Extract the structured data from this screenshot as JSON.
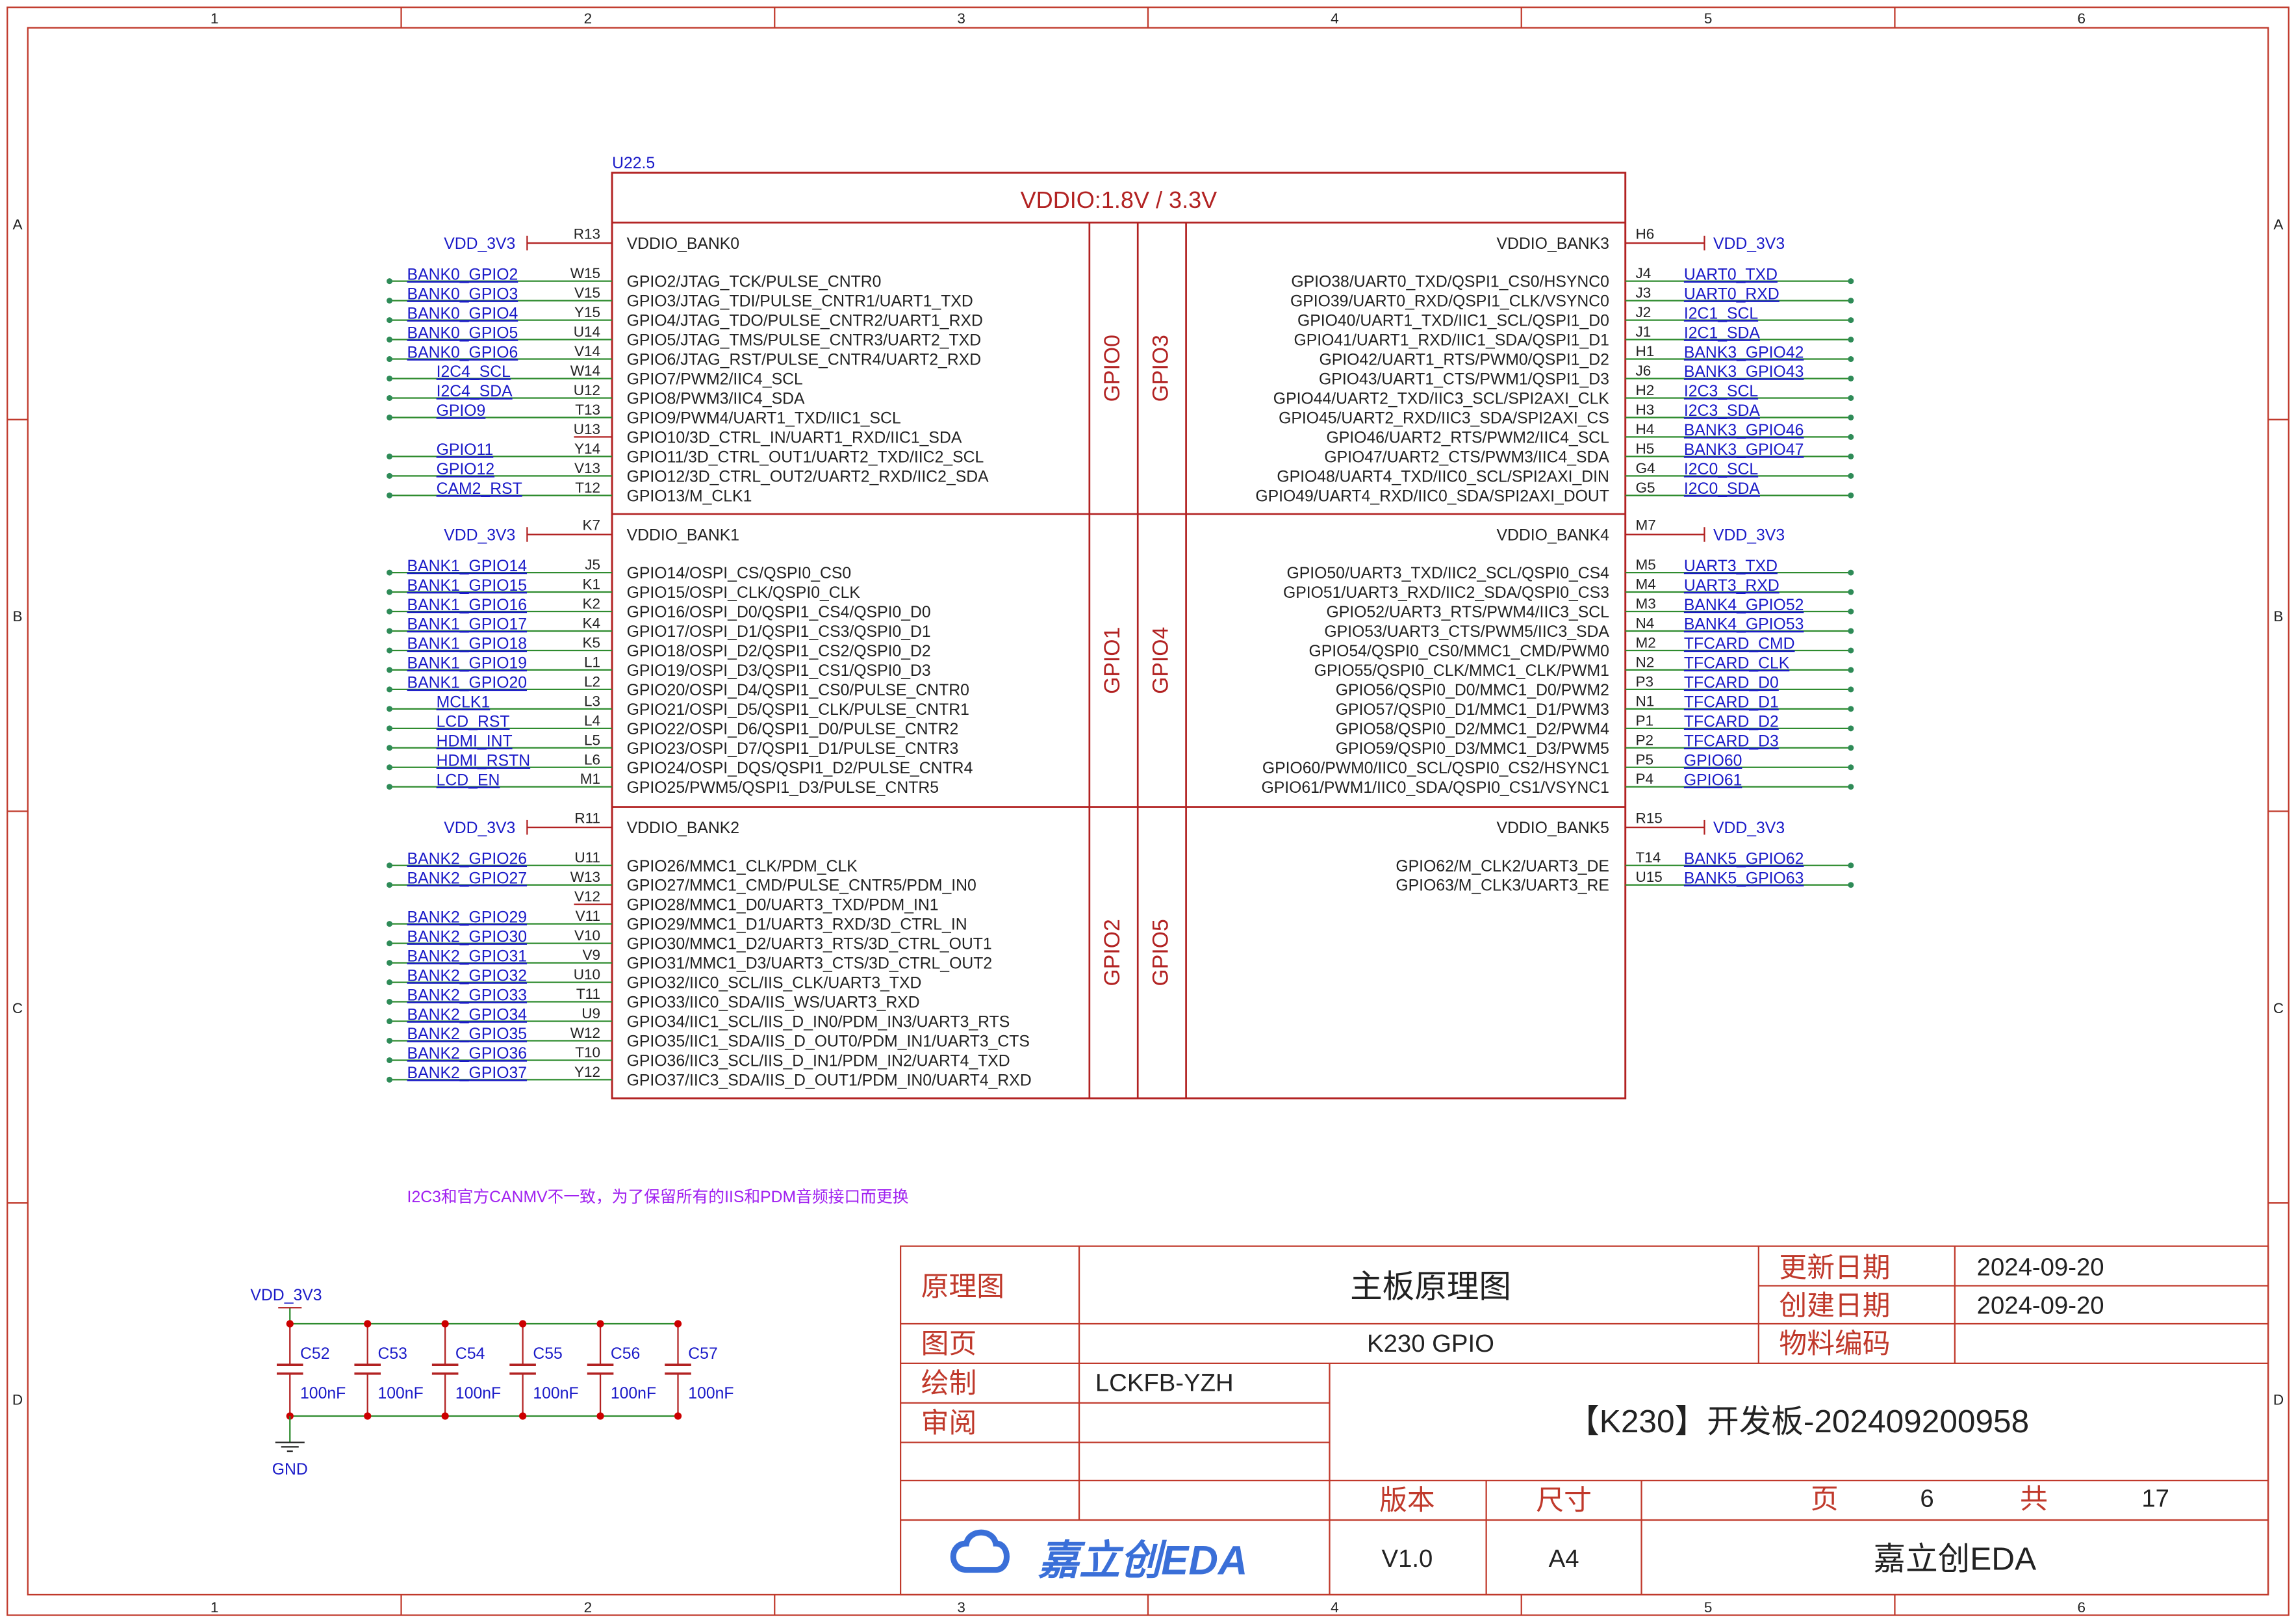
{
  "frame": {
    "columns": [
      "1",
      "2",
      "3",
      "4",
      "5",
      "6"
    ],
    "rows": [
      "A",
      "B",
      "C",
      "D"
    ]
  },
  "colors": {
    "frame": "#c0392b",
    "body": "#b22222",
    "pin": "#b22222",
    "net": "#1a1ac8",
    "wire": "#2e8b2e",
    "note": "#a020f0",
    "pad": "#2e8b57",
    "junction": "#cc0000",
    "black": "#222222",
    "logo": "#3a6fd8"
  },
  "chip": {
    "designator": "U22.5",
    "title": "VDDIO:1.8V / 3.3V",
    "banks": [
      {
        "name": "VDDIO_BANK0",
        "group": "GPIO0",
        "side": "left",
        "power": {
          "net": "VDD_3V3",
          "pin": "R13"
        },
        "pins": [
          {
            "net": "BANK0_GPIO2",
            "pin": "W15",
            "func": "GPIO2/JTAG_TCK/PULSE_CNTR0"
          },
          {
            "net": "BANK0_GPIO3",
            "pin": "V15",
            "func": "GPIO3/JTAG_TDI/PULSE_CNTR1/UART1_TXD"
          },
          {
            "net": "BANK0_GPIO4",
            "pin": "Y15",
            "func": "GPIO4/JTAG_TDO/PULSE_CNTR2/UART1_RXD"
          },
          {
            "net": "BANK0_GPIO5",
            "pin": "U14",
            "func": "GPIO5/JTAG_TMS/PULSE_CNTR3/UART2_TXD"
          },
          {
            "net": "BANK0_GPIO6",
            "pin": "V14",
            "func": "GPIO6/JTAG_RST/PULSE_CNTR4/UART2_RXD"
          },
          {
            "net": "I2C4_SCL",
            "pin": "W14",
            "func": "GPIO7/PWM2/IIC4_SCL"
          },
          {
            "net": "I2C4_SDA",
            "pin": "U12",
            "func": "GPIO8/PWM3/IIC4_SDA"
          },
          {
            "net": "GPIO9",
            "pin": "T13",
            "func": "GPIO9/PWM4/UART1_TXD/IIC1_SCL"
          },
          {
            "net": "",
            "pin": "U13",
            "func": "GPIO10/3D_CTRL_IN/UART1_RXD/IIC1_SDA"
          },
          {
            "net": "GPIO11",
            "pin": "Y14",
            "func": "GPIO11/3D_CTRL_OUT1/UART2_TXD/IIC2_SCL"
          },
          {
            "net": "GPIO12",
            "pin": "V13",
            "func": "GPIO12/3D_CTRL_OUT2/UART2_RXD/IIC2_SDA"
          },
          {
            "net": "CAM2_RST",
            "pin": "T12",
            "func": "GPIO13/M_CLK1"
          }
        ]
      },
      {
        "name": "VDDIO_BANK1",
        "group": "GPIO1",
        "side": "left",
        "power": {
          "net": "VDD_3V3",
          "pin": "K7"
        },
        "pins": [
          {
            "net": "BANK1_GPIO14",
            "pin": "J5",
            "func": "GPIO14/OSPI_CS/QSPI0_CS0"
          },
          {
            "net": "BANK1_GPIO15",
            "pin": "K1",
            "func": "GPIO15/OSPI_CLK/QSPI0_CLK"
          },
          {
            "net": "BANK1_GPIO16",
            "pin": "K2",
            "func": "GPIO16/OSPI_D0/QSPI1_CS4/QSPI0_D0"
          },
          {
            "net": "BANK1_GPIO17",
            "pin": "K4",
            "func": "GPIO17/OSPI_D1/QSPI1_CS3/QSPI0_D1"
          },
          {
            "net": "BANK1_GPIO18",
            "pin": "K5",
            "func": "GPIO18/OSPI_D2/QSPI1_CS2/QSPI0_D2"
          },
          {
            "net": "BANK1_GPIO19",
            "pin": "L1",
            "func": "GPIO19/OSPI_D3/QSPI1_CS1/QSPI0_D3"
          },
          {
            "net": "BANK1_GPIO20",
            "pin": "L2",
            "func": "GPIO20/OSPI_D4/QSPI1_CS0/PULSE_CNTR0"
          },
          {
            "net": "MCLK1",
            "pin": "L3",
            "func": "GPIO21/OSPI_D5/QSPI1_CLK/PULSE_CNTR1"
          },
          {
            "net": "LCD_RST",
            "pin": "L4",
            "func": "GPIO22/OSPI_D6/QSPI1_D0/PULSE_CNTR2"
          },
          {
            "net": "HDMI_INT",
            "pin": "L5",
            "func": "GPIO23/OSPI_D7/QSPI1_D1/PULSE_CNTR3"
          },
          {
            "net": "HDMI_RSTN",
            "pin": "L6",
            "func": "GPIO24/OSPI_DQS/QSPI1_D2/PULSE_CNTR4"
          },
          {
            "net": "LCD_EN",
            "pin": "M1",
            "func": "GPIO25/PWM5/QSPI1_D3/PULSE_CNTR5"
          }
        ]
      },
      {
        "name": "VDDIO_BANK2",
        "group": "GPIO2",
        "side": "left",
        "power": {
          "net": "VDD_3V3",
          "pin": "R11"
        },
        "pins": [
          {
            "net": "BANK2_GPIO26",
            "pin": "U11",
            "func": "GPIO26/MMC1_CLK/PDM_CLK"
          },
          {
            "net": "BANK2_GPIO27",
            "pin": "W13",
            "func": "GPIO27/MMC1_CMD/PULSE_CNTR5/PDM_IN0"
          },
          {
            "net": "",
            "pin": "V12",
            "func": "GPIO28/MMC1_D0/UART3_TXD/PDM_IN1"
          },
          {
            "net": "BANK2_GPIO29",
            "pin": "V11",
            "func": "GPIO29/MMC1_D1/UART3_RXD/3D_CTRL_IN"
          },
          {
            "net": "BANK2_GPIO30",
            "pin": "V10",
            "func": "GPIO30/MMC1_D2/UART3_RTS/3D_CTRL_OUT1"
          },
          {
            "net": "BANK2_GPIO31",
            "pin": "V9",
            "func": "GPIO31/MMC1_D3/UART3_CTS/3D_CTRL_OUT2"
          },
          {
            "net": "BANK2_GPIO32",
            "pin": "U10",
            "func": "GPIO32/IIC0_SCL/IIS_CLK/UART3_TXD"
          },
          {
            "net": "BANK2_GPIO33",
            "pin": "T11",
            "func": "GPIO33/IIC0_SDA/IIS_WS/UART3_RXD"
          },
          {
            "net": "BANK2_GPIO34",
            "pin": "U9",
            "func": "GPIO34/IIC1_SCL/IIS_D_IN0/PDM_IN3/UART3_RTS"
          },
          {
            "net": "BANK2_GPIO35",
            "pin": "W12",
            "func": "GPIO35/IIC1_SDA/IIS_D_OUT0/PDM_IN1/UART3_CTS"
          },
          {
            "net": "BANK2_GPIO36",
            "pin": "T10",
            "func": "GPIO36/IIC3_SCL/IIS_D_IN1/PDM_IN2/UART4_TXD"
          },
          {
            "net": "BANK2_GPIO37",
            "pin": "Y12",
            "func": "GPIO37/IIC3_SDA/IIS_D_OUT1/PDM_IN0/UART4_RXD"
          }
        ]
      },
      {
        "name": "VDDIO_BANK3",
        "group": "GPIO3",
        "side": "right",
        "power": {
          "net": "VDD_3V3",
          "pin": "H6"
        },
        "pins": [
          {
            "net": "UART0_TXD",
            "pin": "J4",
            "func": "GPIO38/UART0_TXD/QSPI1_CS0/HSYNC0"
          },
          {
            "net": "UART0_RXD",
            "pin": "J3",
            "func": "GPIO39/UART0_RXD/QSPI1_CLK/VSYNC0"
          },
          {
            "net": "I2C1_SCL",
            "pin": "J2",
            "func": "GPIO40/UART1_TXD/IIC1_SCL/QSPI1_D0"
          },
          {
            "net": "I2C1_SDA",
            "pin": "J1",
            "func": "GPIO41/UART1_RXD/IIC1_SDA/QSPI1_D1"
          },
          {
            "net": "BANK3_GPIO42",
            "pin": "H1",
            "func": "GPIO42/UART1_RTS/PWM0/QSPI1_D2"
          },
          {
            "net": "BANK3_GPIO43",
            "pin": "J6",
            "func": "GPIO43/UART1_CTS/PWM1/QSPI1_D3"
          },
          {
            "net": "I2C3_SCL",
            "pin": "H2",
            "func": "GPIO44/UART2_TXD/IIC3_SCL/SPI2AXI_CLK"
          },
          {
            "net": "I2C3_SDA",
            "pin": "H3",
            "func": "GPIO45/UART2_RXD/IIC3_SDA/SPI2AXI_CS"
          },
          {
            "net": "BANK3_GPIO46",
            "pin": "H4",
            "func": "GPIO46/UART2_RTS/PWM2/IIC4_SCL"
          },
          {
            "net": "BANK3_GPIO47",
            "pin": "H5",
            "func": "GPIO47/UART2_CTS/PWM3/IIC4_SDA"
          },
          {
            "net": "I2C0_SCL",
            "pin": "G4",
            "func": "GPIO48/UART4_TXD/IIC0_SCL/SPI2AXI_DIN"
          },
          {
            "net": "I2C0_SDA",
            "pin": "G5",
            "func": "GPIO49/UART4_RXD/IIC0_SDA/SPI2AXI_DOUT"
          }
        ]
      },
      {
        "name": "VDDIO_BANK4",
        "group": "GPIO4",
        "side": "right",
        "power": {
          "net": "VDD_3V3",
          "pin": "M7"
        },
        "pins": [
          {
            "net": "UART3_TXD",
            "pin": "M5",
            "func": "GPIO50/UART3_TXD/IIC2_SCL/QSPI0_CS4"
          },
          {
            "net": "UART3_RXD",
            "pin": "M4",
            "func": "GPIO51/UART3_RXD/IIC2_SDA/QSPI0_CS3"
          },
          {
            "net": "BANK4_GPIO52",
            "pin": "M3",
            "func": "GPIO52/UART3_RTS/PWM4/IIC3_SCL"
          },
          {
            "net": "BANK4_GPIO53",
            "pin": "N4",
            "func": "GPIO53/UART3_CTS/PWM5/IIC3_SDA"
          },
          {
            "net": "TFCARD_CMD",
            "pin": "M2",
            "func": "GPIO54/QSPI0_CS0/MMC1_CMD/PWM0"
          },
          {
            "net": "TFCARD_CLK",
            "pin": "N2",
            "func": "GPIO55/QSPI0_CLK/MMC1_CLK/PWM1"
          },
          {
            "net": "TFCARD_D0",
            "pin": "P3",
            "func": "GPIO56/QSPI0_D0/MMC1_D0/PWM2"
          },
          {
            "net": "TFCARD_D1",
            "pin": "N1",
            "func": "GPIO57/QSPI0_D1/MMC1_D1/PWM3"
          },
          {
            "net": "TFCARD_D2",
            "pin": "P1",
            "func": "GPIO58/QSPI0_D2/MMC1_D2/PWM4"
          },
          {
            "net": "TFCARD_D3",
            "pin": "P2",
            "func": "GPIO59/QSPI0_D3/MMC1_D3/PWM5"
          },
          {
            "net": "GPIO60",
            "pin": "P5",
            "func": "GPIO60/PWM0/IIC0_SCL/QSPI0_CS2/HSYNC1"
          },
          {
            "net": "GPIO61",
            "pin": "P4",
            "func": "GPIO61/PWM1/IIC0_SDA/QSPI0_CS1/VSYNC1"
          }
        ]
      },
      {
        "name": "VDDIO_BANK5",
        "group": "GPIO5",
        "side": "right",
        "power": {
          "net": "VDD_3V3",
          "pin": "R15"
        },
        "pins": [
          {
            "net": "BANK5_GPIO62",
            "pin": "T14",
            "func": "GPIO62/M_CLK2/UART3_DE"
          },
          {
            "net": "BANK5_GPIO63",
            "pin": "U15",
            "func": "GPIO63/M_CLK3/UART3_RE"
          }
        ]
      }
    ]
  },
  "note": "I2C3和官方CANMV不一致，为了保留所有的IIS和PDM音频接口而更换",
  "decoupling": {
    "power_net": "VDD_3V3",
    "ground_net": "GND",
    "caps": [
      {
        "ref": "C52",
        "value": "100nF"
      },
      {
        "ref": "C53",
        "value": "100nF"
      },
      {
        "ref": "C54",
        "value": "100nF"
      },
      {
        "ref": "C55",
        "value": "100nF"
      },
      {
        "ref": "C56",
        "value": "100nF"
      },
      {
        "ref": "C57",
        "value": "100nF"
      }
    ]
  },
  "title_block": {
    "type_label": "原理图",
    "type_value": "主板原理图",
    "updated_label": "更新日期",
    "updated_value": "2024-09-20",
    "created_label": "创建日期",
    "created_value": "2024-09-20",
    "page_label": "图页",
    "page_value": "K230 GPIO",
    "material_label": "物料编码",
    "material_value": "",
    "drawn_label": "绘制",
    "drawn_value": "LCKFB-YZH",
    "review_label": "审阅",
    "review_value": "",
    "project": "【K230】开发板-202409200958",
    "version_label": "版本",
    "version_value": "V1.0",
    "size_label": "尺寸",
    "size_value": "A4",
    "sheet_label": "页",
    "sheet_value": "6",
    "total_label": "共",
    "total_value": "17",
    "logo_text": "嘉立创EDA",
    "company": "嘉立创EDA"
  }
}
